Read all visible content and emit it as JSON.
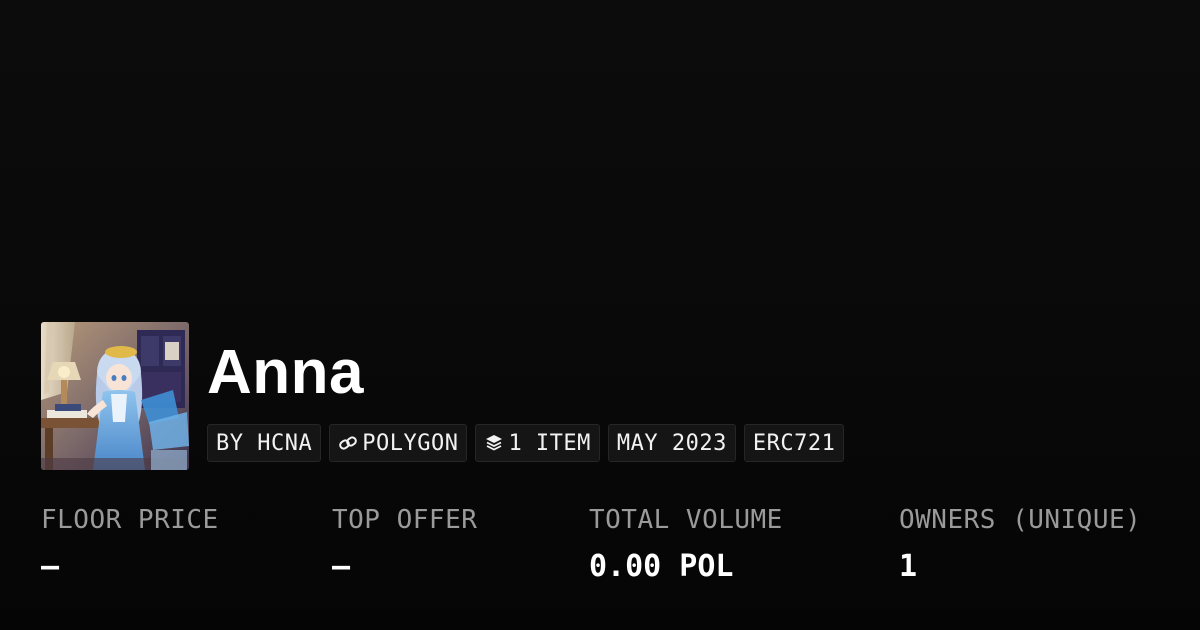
{
  "collection": {
    "name": "Anna",
    "creator": "BY HCNA",
    "chain": "POLYGON",
    "items": "1 ITEM",
    "date": "MAY 2023",
    "standard": "ERC721"
  },
  "stats": [
    {
      "label": "FLOOR PRICE",
      "value": "—"
    },
    {
      "label": "TOP OFFER",
      "value": "—"
    },
    {
      "label": "TOTAL VOLUME",
      "value": "0.00 POL"
    },
    {
      "label": "OWNERS (UNIQUE)",
      "value": "1"
    }
  ],
  "icons": {
    "chain": "link-icon",
    "items": "layers-icon",
    "avatar": "collection-avatar-anime-girl"
  },
  "colors": {
    "background": "#0a0a0a",
    "chip_background": "#151515",
    "label": "#9a9a9a",
    "text": "#ffffff"
  }
}
